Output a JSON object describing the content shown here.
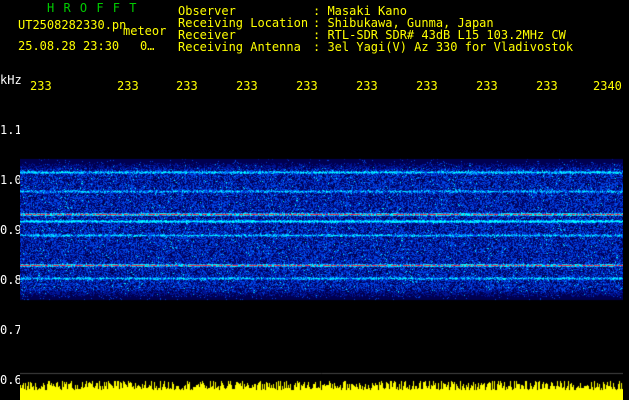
{
  "header": {
    "app_title": "H R O F F T",
    "filename": "UT2508282330.pn",
    "mode_label": "meteor",
    "datetime": "25.08.28 23:30",
    "counter": "0",
    "counter_suffix": "…"
  },
  "station_info": {
    "labels": [
      "Observer",
      "Receiving Location",
      "Receiver",
      "Receiving Antenna"
    ],
    "values": [
      ": Masaki Kano",
      ": Shibukawa, Gunma, Japan",
      ": RTL-SDR SDR# 43dB L15 103.2MHz CW",
      ": 3el Yagi(V) Az 330 for Vladivostok"
    ]
  },
  "time_axis": {
    "ticks": [
      "233",
      "233",
      "233",
      "233",
      "233",
      "233",
      "233",
      "233",
      "233",
      "2340"
    ]
  },
  "freq_axis": {
    "unit": "kHz",
    "ticks": [
      "1.1",
      "1.0",
      "0.9",
      "0.8",
      "0.7",
      "0.6"
    ]
  },
  "colors": {
    "label_text": "#ffff00",
    "title_text": "#00cc00",
    "background": "#000000",
    "noise_low": "#000080",
    "noise_mid": "#0044ff",
    "noise_high": "#00ccff",
    "signal_peak": "#ff3030",
    "noise_floor_bars": "#ffff00"
  }
}
